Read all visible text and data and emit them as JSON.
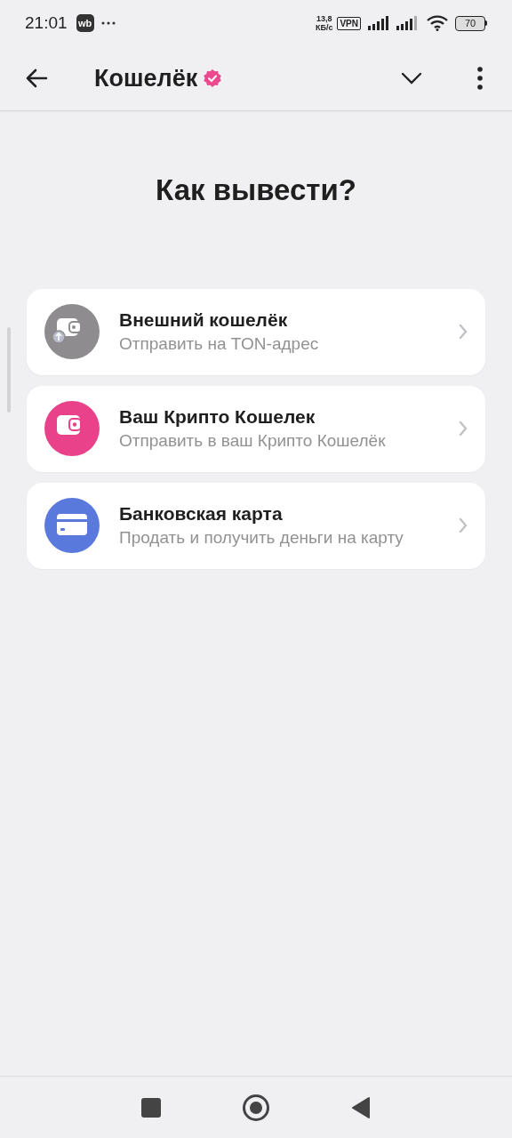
{
  "status_bar": {
    "time": "21:01",
    "app_badge": "wb",
    "net_speed_value": "13,8",
    "net_speed_unit": "КБ/с",
    "vpn": "VPN",
    "battery": "70"
  },
  "app_bar": {
    "title": "Кошелёк",
    "verified": true
  },
  "heading": "Как вывести?",
  "options": [
    {
      "kind": "external",
      "color": "#8e8c8e",
      "title": "Внешний кошелёк",
      "subtitle": "Отправить на TON-адрес"
    },
    {
      "kind": "crypto",
      "color": "#e9428a",
      "title": "Ваш Крипто Кошелек",
      "subtitle": "Отправить в ваш Крипто Кошелёк"
    },
    {
      "kind": "card",
      "color": "#5a79dc",
      "title": "Банковская карта",
      "subtitle": "Продать и получить деньги на карту"
    }
  ]
}
